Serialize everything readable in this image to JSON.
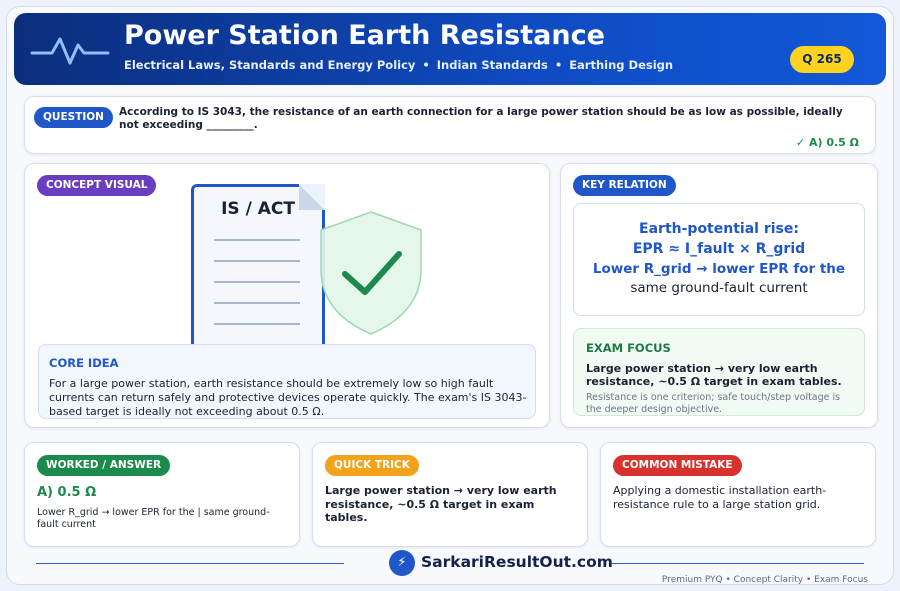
{
  "header": {
    "title": "Power Station Earth Resistance",
    "subtitle_parts": [
      "Electrical Laws, Standards and Energy Policy",
      "Indian Standards",
      "Earthing Design"
    ],
    "separator": "•",
    "question_badge": "Q 265"
  },
  "question": {
    "label": "QUESTION",
    "text": "According to IS 3043, the resistance of an earth connection for a large power station should be as low as possible, ideally not exceeding _________.",
    "answer": "✓ A) 0.5 Ω"
  },
  "concept": {
    "label": "CONCEPT VISUAL",
    "document_title": "IS / ACT",
    "core_idea_heading": "CORE IDEA",
    "core_idea_text": "For a large power station, earth resistance should be extremely low so high fault currents can return safely and protective devices operate quickly. The exam's IS 3043-based target is ideally not exceeding about 0.5 Ω."
  },
  "key_relation": {
    "label": "KEY RELATION",
    "line1": "Earth-potential rise:",
    "line2": "EPR ≈ I_fault × R_grid",
    "line3_bold": "Lower R_grid → lower EPR for the",
    "line3_rest": "same ground-fault current"
  },
  "exam_focus": {
    "heading": "EXAM FOCUS",
    "text": "Large power station → very low earth resistance, ~0.5 Ω target in exam tables.",
    "note": "Resistance is one criterion; safe touch/step voltage is the deeper design objective."
  },
  "worked": {
    "label": "WORKED / ANSWER",
    "answer": "A) 0.5 Ω",
    "text": "Lower R_grid → lower EPR for the | same ground-fault current"
  },
  "quick_trick": {
    "label": "QUICK TRICK",
    "text": "Large power station → very low earth resistance, ~0.5 Ω target in exam tables."
  },
  "common_mistake": {
    "label": "COMMON MISTAKE",
    "text": "Applying a domestic installation earth-resistance rule to a large station grid."
  },
  "footer": {
    "logo_glyph": "⚡",
    "brand": "SarkariResultOut.com",
    "tagline": "Premium PYQ • Concept Clarity • Exam Focus"
  },
  "colors": {
    "primary": "#1f57c8",
    "success": "#1d8a4d",
    "warning": "#f3a21b",
    "danger": "#d8322f",
    "accent_purple": "#6a3fbf",
    "badge_yellow": "#ffd21f"
  }
}
